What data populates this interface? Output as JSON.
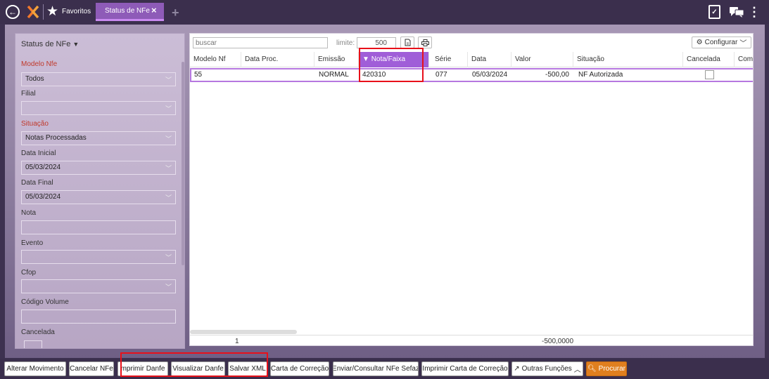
{
  "topbar": {
    "favorites_label": "Favoritos",
    "tab_label": "Status de NFe",
    "tab_close": "×",
    "add_tab": "+"
  },
  "sidebar": {
    "title": "Status de NFe",
    "fields": [
      {
        "label": "Modelo Nfe",
        "value": "Todos",
        "required": true,
        "dropdown": true
      },
      {
        "label": "Filial",
        "value": "",
        "required": false,
        "dropdown": true
      },
      {
        "label": "Situação",
        "value": "Notas Processadas",
        "required": true,
        "dropdown": true
      },
      {
        "label": "Data Inicial",
        "value": "05/03/2024",
        "required": false,
        "dropdown": true
      },
      {
        "label": "Data Final",
        "value": "05/03/2024",
        "required": false,
        "dropdown": true
      },
      {
        "label": "Nota",
        "value": "",
        "required": false,
        "dropdown": false
      },
      {
        "label": "Evento",
        "value": "",
        "required": false,
        "dropdown": true
      },
      {
        "label": "Cfop",
        "value": "",
        "required": false,
        "dropdown": true
      },
      {
        "label": "Código Volume",
        "value": "",
        "required": false,
        "dropdown": false
      }
    ],
    "cancelada_label": "Cancelada"
  },
  "grid": {
    "search_placeholder": "buscar",
    "limit_label": "limite:",
    "limit_value": "500",
    "config_label": "Configurar",
    "columns": [
      "Modelo Nf",
      "Data Proc.",
      "Emissão",
      "Nota/Faixa",
      "Série",
      "Data",
      "Valor",
      "Situação",
      "Cancelada",
      "Comp"
    ],
    "active_column": "Nota/Faixa",
    "rows": [
      {
        "modelo": "55",
        "data_proc": "",
        "emissao": "NORMAL",
        "nota": "420310",
        "serie": "077",
        "data": "05/03/2024",
        "valor": "-500,00",
        "situacao": "NF Autorizada"
      }
    ],
    "footer_count": "1",
    "footer_total": "-500,0000"
  },
  "actions": {
    "alterar": "Alterar Movimento",
    "cancelar": "Cancelar NFe",
    "imprimir": "mprimir Danfe",
    "visualizar": "Visualizar Danfe",
    "salvar": "Salvar XML",
    "carta": "Carta de Correção",
    "enviar": "Enviar/Consultar NFe Sefaz",
    "imprimir_carta": "Imprimir Carta de Correção",
    "outras": "Outras Funções",
    "procurar": "Procurar"
  },
  "colors": {
    "topbar": "#3b2f4d",
    "accent": "#a05ed8",
    "primary_button": "#e07f1f",
    "highlight": "#e8101a"
  }
}
